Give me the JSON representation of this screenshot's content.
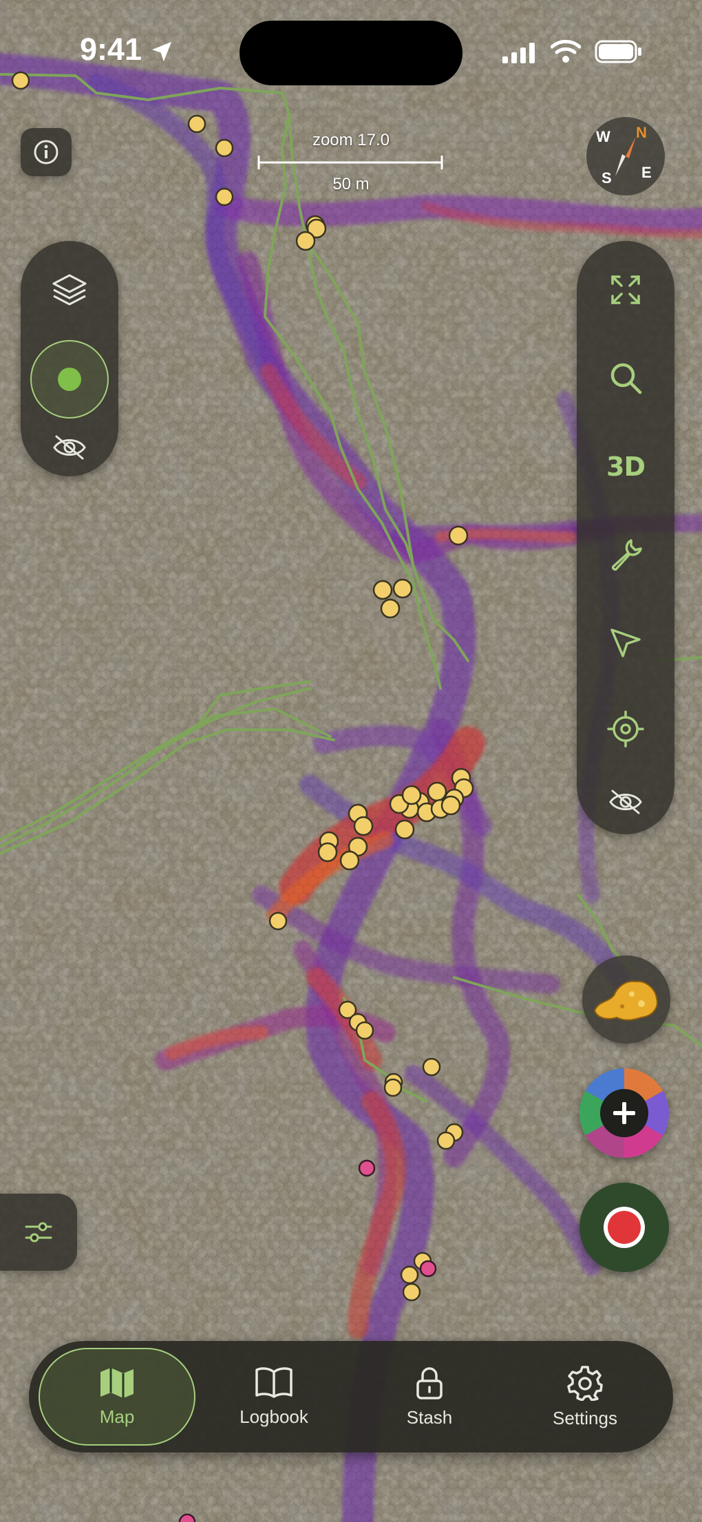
{
  "status_bar": {
    "time": "9:41",
    "icons": [
      "location-arrow-icon",
      "signal-icon",
      "wifi-icon",
      "battery-icon"
    ]
  },
  "map": {
    "zoom_label": "zoom 17.0",
    "scale_label": "50 m",
    "compass": {
      "n": "N",
      "e": "E",
      "s": "S",
      "w": "W"
    }
  },
  "left_controls": {
    "icons": [
      "info-icon",
      "layers-icon",
      "location-toggle-icon",
      "hide-icon"
    ]
  },
  "right_toolbar": {
    "icons": [
      "fullscreen-icon",
      "search-icon",
      "wrench-icon",
      "navigate-icon",
      "crosshair-icon",
      "hide-icon"
    ],
    "three_d_label": "3D"
  },
  "fab": {
    "icons": [
      "nugget-icon",
      "add-icon",
      "record-icon"
    ]
  },
  "filter": {
    "icon": "sliders-icon"
  },
  "tabs": [
    {
      "label": "Map",
      "icon": "map-icon",
      "active": true
    },
    {
      "label": "Logbook",
      "icon": "book-icon",
      "active": false
    },
    {
      "label": "Stash",
      "icon": "lock-icon",
      "active": false
    },
    {
      "label": "Settings",
      "icon": "gear-icon",
      "active": false
    }
  ],
  "colors": {
    "accent": "#a7cf7e",
    "panel": "#302e28",
    "record": "#e0363a",
    "marker": "#f2cf6b"
  }
}
